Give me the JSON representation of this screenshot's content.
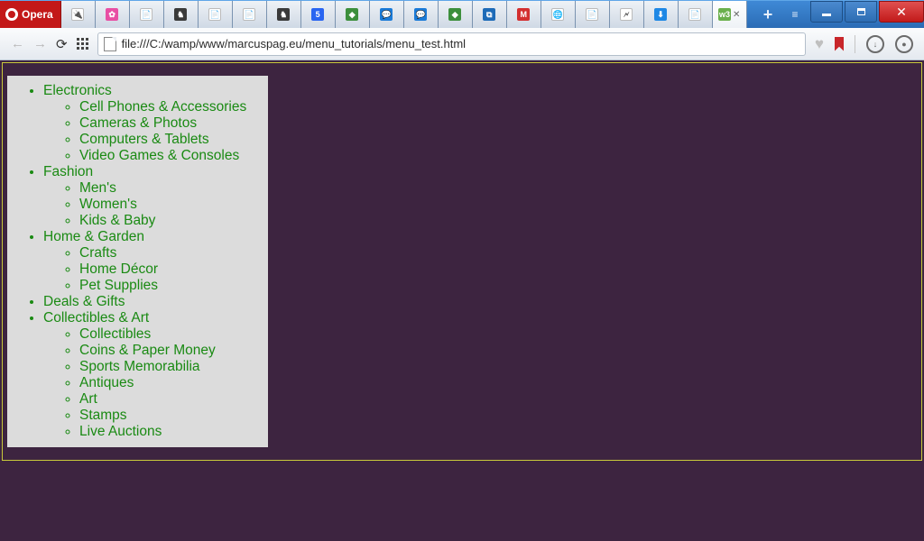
{
  "window": {
    "app_label": "Opera",
    "url": "file:///C:/wamp/www/marcuspag.eu/menu_tutorials/menu_test.html"
  },
  "tabs": {
    "count": 22,
    "active_index": 19,
    "icons": [
      {
        "glyph": "🔌",
        "bg": "#fff"
      },
      {
        "glyph": "✿",
        "bg": "#e84fa4"
      },
      {
        "glyph": "📄",
        "bg": "#fff"
      },
      {
        "glyph": "♞",
        "bg": "#3a3a3a"
      },
      {
        "glyph": "📄",
        "bg": "#fff"
      },
      {
        "glyph": "📄",
        "bg": "#fff"
      },
      {
        "glyph": "♞",
        "bg": "#3a3a3a"
      },
      {
        "glyph": "5",
        "bg": "#2965f1"
      },
      {
        "glyph": "◆",
        "bg": "#3c8f3c"
      },
      {
        "glyph": "💬",
        "bg": "#1b7bd8"
      },
      {
        "glyph": "💬",
        "bg": "#1b7bd8"
      },
      {
        "glyph": "◆",
        "bg": "#3c8f3c"
      },
      {
        "glyph": "⧉",
        "bg": "#1e6bb8"
      },
      {
        "glyph": "M",
        "bg": "#d32f2f"
      },
      {
        "glyph": "🌐",
        "bg": "#fff"
      },
      {
        "glyph": "📄",
        "bg": "#fff"
      },
      {
        "glyph": "🗲",
        "bg": "#fff"
      },
      {
        "glyph": "⬇",
        "bg": "#1e88e5"
      },
      {
        "glyph": "📄",
        "bg": "#fff"
      },
      {
        "glyph": "w3",
        "bg": "#6ab04c"
      }
    ]
  },
  "menu": {
    "categories": [
      {
        "label": "Electronics",
        "items": [
          "Cell Phones & Accessories",
          "Cameras & Photos",
          "Computers & Tablets",
          "Video Games & Consoles"
        ]
      },
      {
        "label": "Fashion",
        "items": [
          "Men's",
          "Women's",
          "Kids & Baby"
        ]
      },
      {
        "label": "Home & Garden",
        "items": [
          "Crafts",
          "Home Décor",
          "Pet Supplies"
        ]
      },
      {
        "label": "Deals & Gifts",
        "items": []
      },
      {
        "label": "Collectibles & Art",
        "items": [
          "Collectibles",
          "Coins & Paper Money",
          "Sports Memorabilia",
          "Antiques",
          "Art",
          "Stamps",
          "Live Auctions"
        ]
      }
    ]
  }
}
